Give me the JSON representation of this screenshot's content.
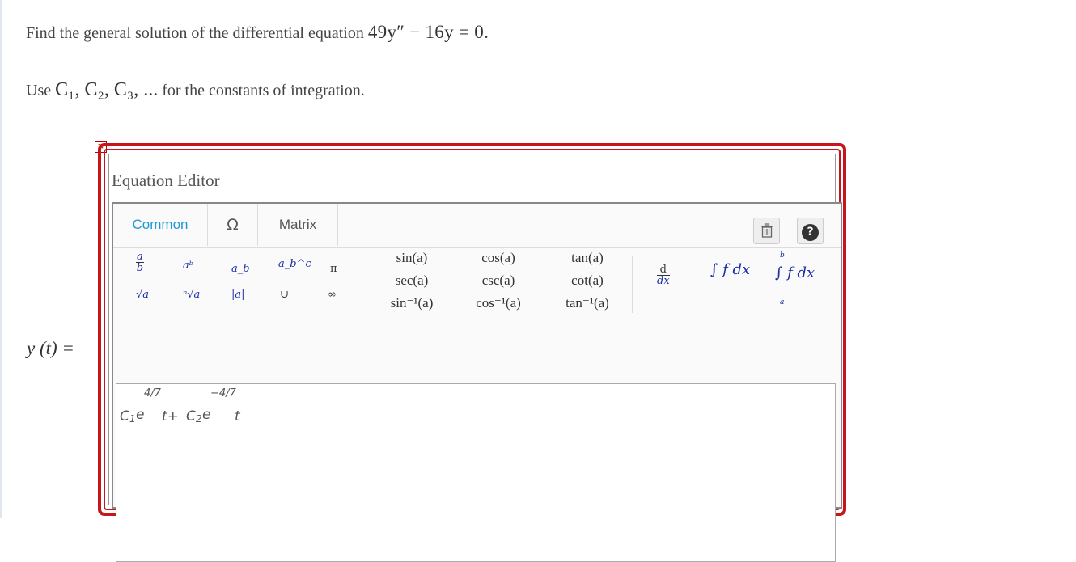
{
  "question": {
    "prefix": "Find the general solution of the differential equation ",
    "equation": "49y″ − 16y = 0."
  },
  "instruction": {
    "prefix": "Use ",
    "constants": "C₁, C₂, C₃, ...",
    "suffix": " for the constants of integration."
  },
  "editor": {
    "close": "×",
    "title": "Equation Editor",
    "tabs": [
      {
        "label": "Common",
        "active": true
      },
      {
        "label": "Ω",
        "active": false
      },
      {
        "label": "Matrix",
        "active": false
      }
    ],
    "trash_icon": "trash-icon",
    "help_label": "?",
    "palette": {
      "frac_num": "a",
      "frac_den": "b",
      "power": "aᵇ",
      "subscript": "a_b",
      "subsup": "a_b^c",
      "pi": "π",
      "sqrt": "√a",
      "nth_root": "ⁿ√a",
      "abs": "|a|",
      "union": "∪",
      "infinity": "∞",
      "trig": [
        [
          "sin(a)",
          "cos(a)",
          "tan(a)"
        ],
        [
          "sec(a)",
          "csc(a)",
          "cot(a)"
        ],
        [
          "sin⁻¹(a)",
          "cos⁻¹(a)",
          "tan⁻¹(a)"
        ]
      ],
      "derivative_num": "d",
      "derivative_den": "dx",
      "integral": "∫ f dx",
      "def_integral_upper": "b",
      "def_integral_lower": "a",
      "def_integral": "∫ f dx"
    },
    "answer_label": "y (t) =",
    "answer_value": "C₁e^(4/7 t) + C₂e^(−4/7 t)",
    "answer_parts": {
      "c1": "C",
      "c1_sub": "1",
      "e1": "e",
      "exp1": "4/7",
      "t1": "t+",
      "c2": "C",
      "c2_sub": "2",
      "e2": "e",
      "exp2": "−4/7",
      "t2": "t"
    }
  }
}
